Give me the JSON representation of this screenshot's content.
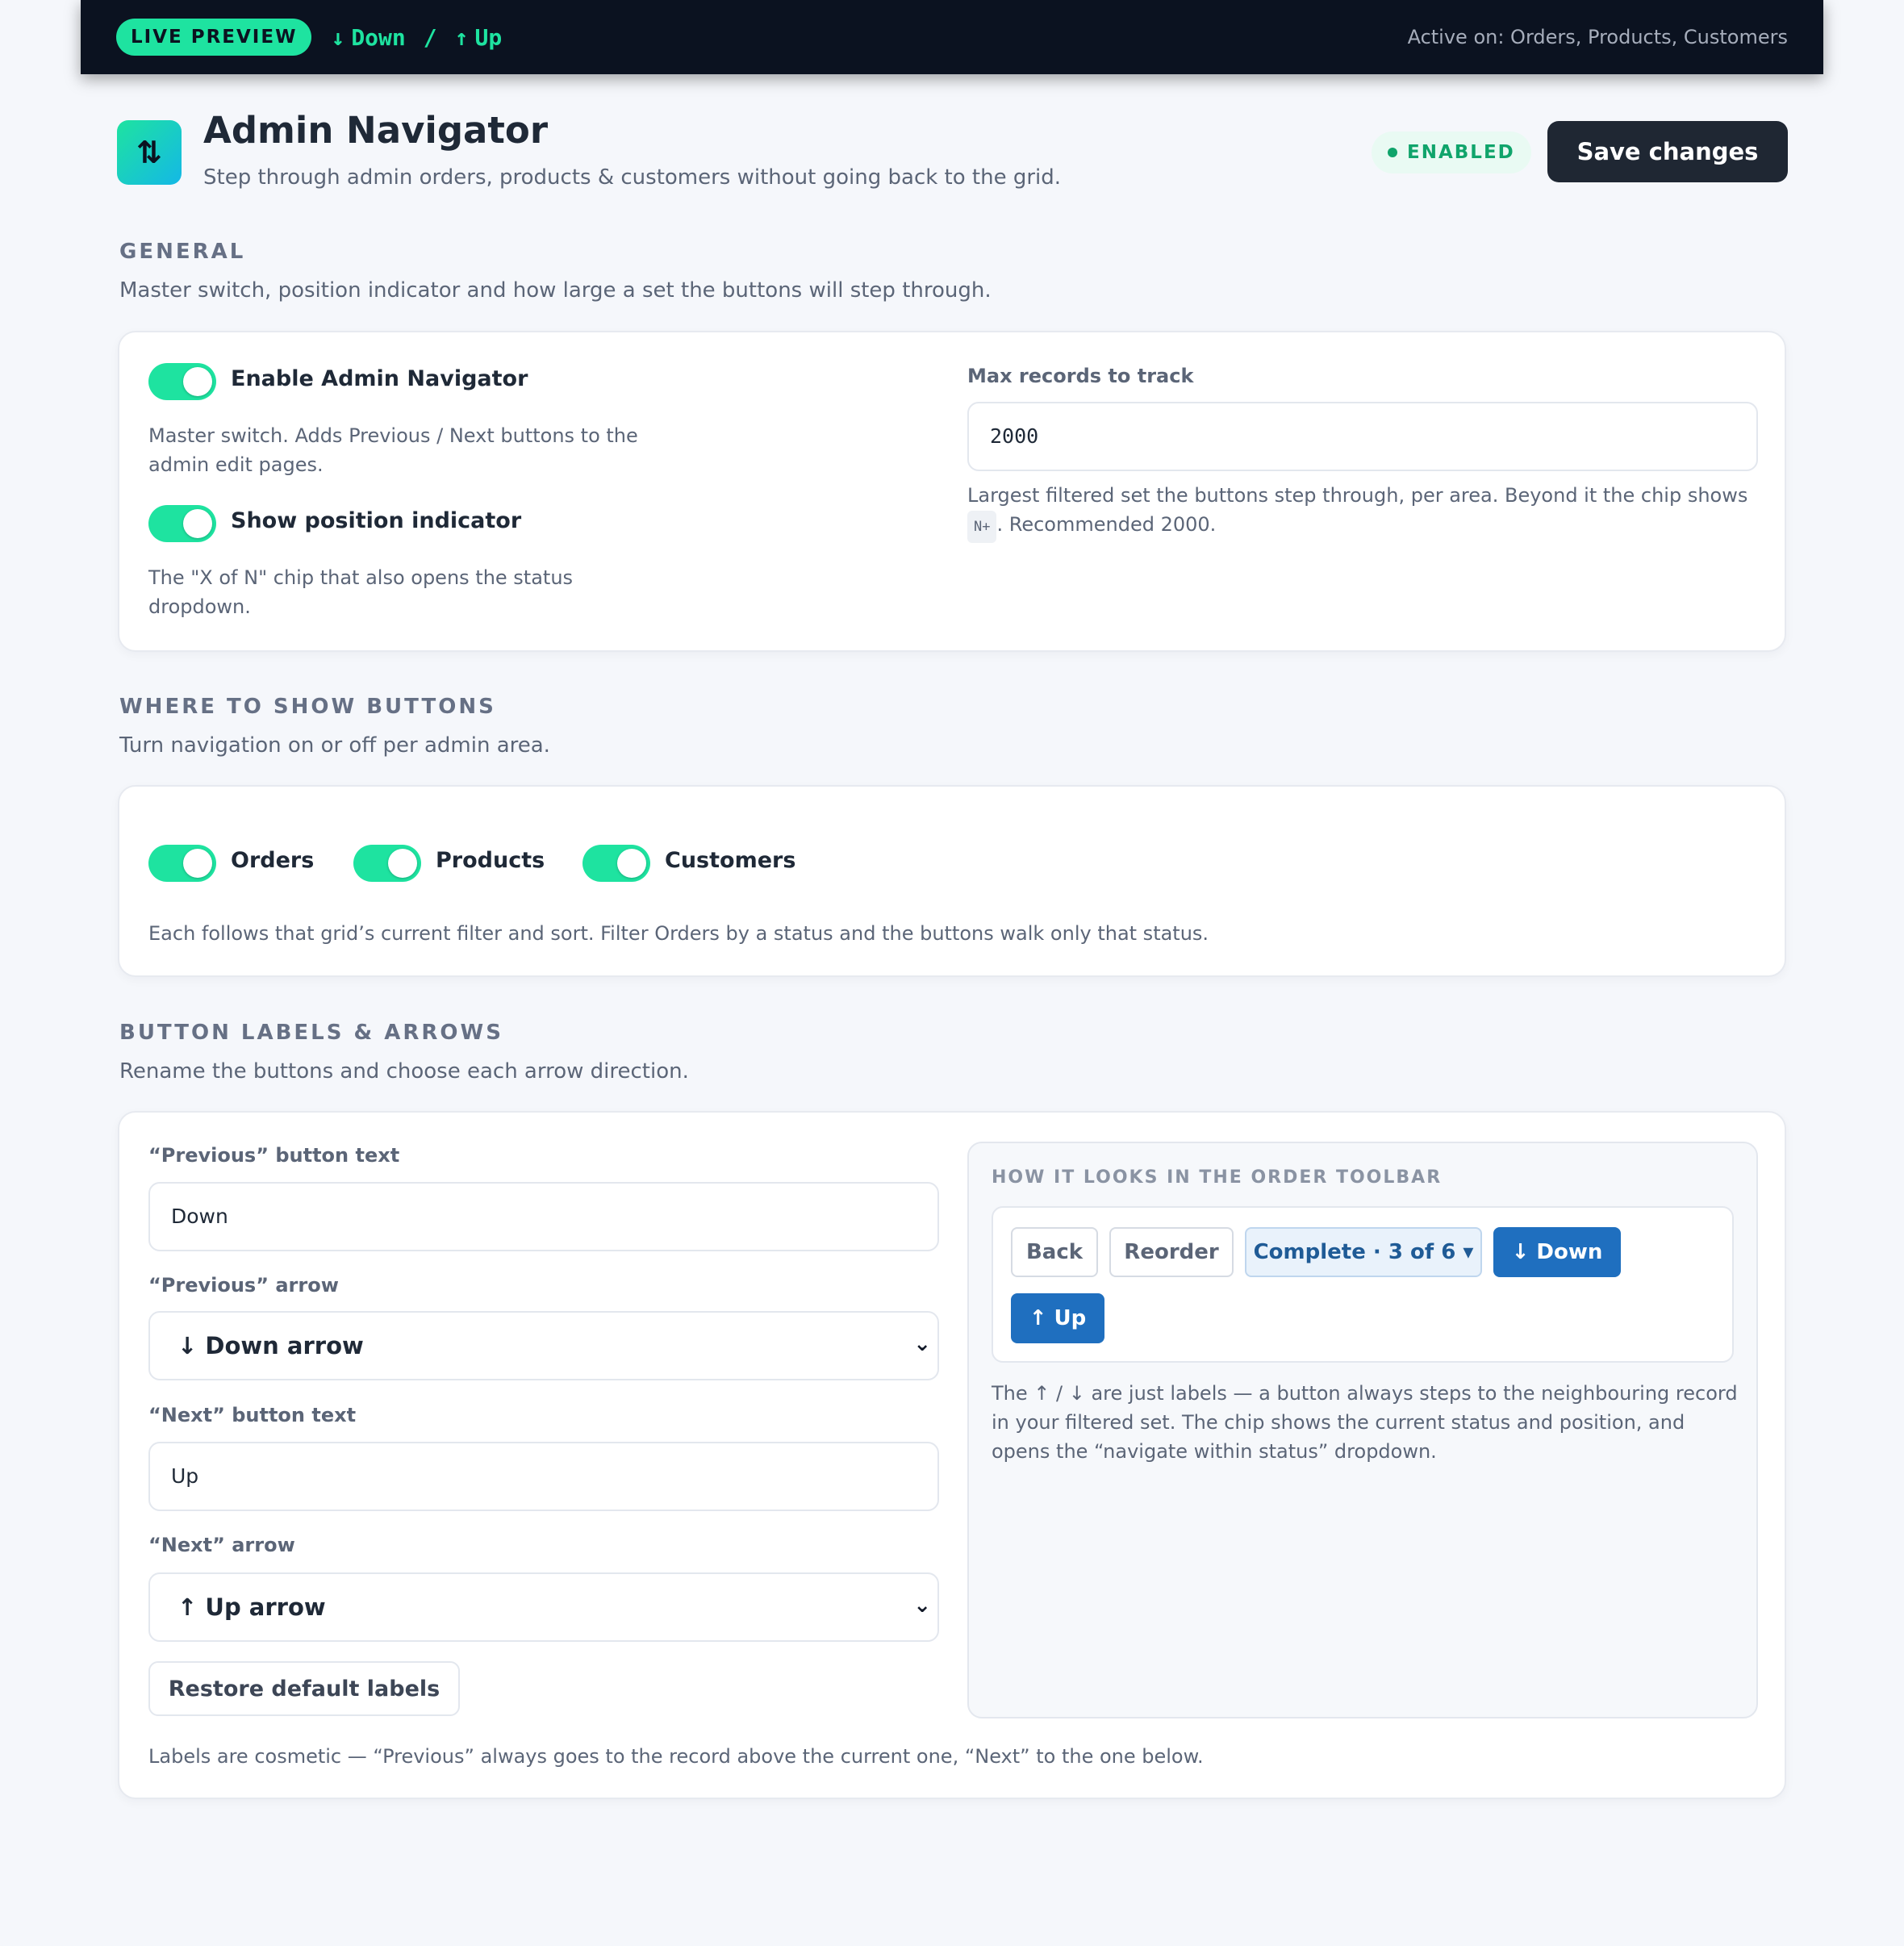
{
  "topbar": {
    "live_label": "LIVE PREVIEW",
    "down_label": "Down",
    "separator": "/",
    "up_label": "Up",
    "active_text": "Active on: Orders, Products, Customers"
  },
  "header": {
    "title": "Admin Navigator",
    "subtitle": "Step through admin orders, products & customers without going back to the grid.",
    "status_badge": "ENABLED",
    "save_label": "Save changes"
  },
  "general": {
    "title": "GENERAL",
    "description": "Master switch, position indicator and how large a set the buttons will step through.",
    "enable_label": "Enable Admin Navigator",
    "enable_on": true,
    "enable_help": "Master switch. Adds Previous / Next buttons to the admin edit pages.",
    "position_label": "Show position indicator",
    "position_on": true,
    "position_help": "The \"X of N\" chip that also opens the status dropdown.",
    "max_label": "Max records to track",
    "max_value": "2000",
    "max_help_before": "Largest filtered set the buttons step through, per area. Beyond it the chip shows",
    "max_help_code": "N+",
    "max_help_after": ". Recommended 2000."
  },
  "where": {
    "title": "WHERE TO SHOW BUTTONS",
    "description": "Turn navigation on or off per admin area.",
    "areas": [
      {
        "label": "Orders",
        "on": true
      },
      {
        "label": "Products",
        "on": true
      },
      {
        "label": "Customers",
        "on": true
      }
    ],
    "help": "Each follows that grid’s current filter and sort. Filter Orders by a status and the buttons walk only that status."
  },
  "labels": {
    "title": "BUTTON LABELS & ARROWS",
    "description": "Rename the buttons and choose each arrow direction.",
    "prev_text_label": "“Previous” button text",
    "prev_text_value": "Down",
    "prev_arrow_label": "“Previous” arrow",
    "prev_arrow_value": "↓ Down arrow",
    "next_text_label": "“Next” button text",
    "next_text_value": "Up",
    "next_arrow_label": "“Next” arrow",
    "next_arrow_value": "↑ Up arrow",
    "restore_label": "Restore default labels",
    "footer_help": "Labels are cosmetic — “Previous” always goes to the record above the current one, “Next” to the one below."
  },
  "preview": {
    "title": "HOW IT LOOKS IN THE ORDER TOOLBAR",
    "back": "Back",
    "reorder": "Reorder",
    "chip": "Complete · 3 of 6 ▾",
    "down": "↓ Down",
    "up": "↑ Up",
    "help": "The ↑ / ↓ are just labels — a button always steps to the neighbouring record in your filtered set. The chip shows the current status and position, and opens the “navigate within status” dropdown."
  },
  "colors": {
    "accent": "#1ee3a0",
    "topbar_bg": "#0b1220",
    "primary_blue": "#1f6fbf",
    "save_bg": "#1f2733"
  }
}
